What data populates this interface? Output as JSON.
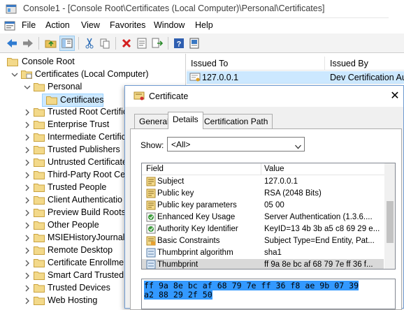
{
  "window": {
    "title": "Console1 - [Console Root\\Certificates (Local Computer)\\Personal\\Certificates]"
  },
  "menubar": [
    "File",
    "Action",
    "View",
    "Favorites",
    "Window",
    "Help"
  ],
  "toolbar": {
    "buttons": [
      "back-icon",
      "forward-icon",
      "up-folder-icon",
      "show-hide-tree-icon",
      "cut-icon",
      "copy-icon",
      "delete-icon",
      "properties-icon",
      "export-icon",
      "help-icon",
      "help-book-icon"
    ]
  },
  "tree": {
    "items": [
      {
        "label": "Console Root"
      },
      {
        "label": "Certificates (Local Computer)"
      },
      {
        "label": "Personal"
      },
      {
        "label": "Certificates"
      },
      {
        "label": "Trusted Root Certific"
      },
      {
        "label": "Enterprise Trust"
      },
      {
        "label": "Intermediate Certific"
      },
      {
        "label": "Trusted Publishers"
      },
      {
        "label": "Untrusted Certificate"
      },
      {
        "label": "Third-Party Root Ce"
      },
      {
        "label": "Trusted People"
      },
      {
        "label": "Client Authenticatio"
      },
      {
        "label": "Preview Build Roots"
      },
      {
        "label": "Other People"
      },
      {
        "label": "MSIEHistoryJournal"
      },
      {
        "label": "Remote Desktop"
      },
      {
        "label": "Certificate Enrollmer"
      },
      {
        "label": "Smart Card Trusted R"
      },
      {
        "label": "Trusted Devices"
      },
      {
        "label": "Web Hosting"
      }
    ]
  },
  "list": {
    "columns": [
      "Issued To",
      "Issued By"
    ],
    "rows": [
      {
        "issued_to": "127.0.0.1",
        "issued_by": "Dev Certification Au"
      }
    ]
  },
  "dialog": {
    "title": "Certificate",
    "tabs": [
      "General",
      "Details",
      "Certification Path"
    ],
    "active_tab": "Details",
    "show_label": "Show:",
    "show_value": "<All>",
    "fields_columns": [
      "Field",
      "Value"
    ],
    "fields": [
      {
        "field": "Subject",
        "value": "127.0.0.1",
        "icon": "cert-field-icon"
      },
      {
        "field": "Public key",
        "value": "RSA (2048 Bits)",
        "icon": "cert-field-icon"
      },
      {
        "field": "Public key parameters",
        "value": "05 00",
        "icon": "cert-field-icon"
      },
      {
        "field": "Enhanced Key Usage",
        "value": "Server Authentication (1.3.6....",
        "icon": "extension-icon"
      },
      {
        "field": "Authority Key Identifier",
        "value": "KeyID=13 4b 3b a5 c8 69 29 e...",
        "icon": "extension-icon"
      },
      {
        "field": "Basic Constraints",
        "value": "Subject Type=End Entity, Pat...",
        "icon": "critical-extension-icon"
      },
      {
        "field": "Thumbprint algorithm",
        "value": "sha1",
        "icon": "property-icon"
      },
      {
        "field": "Thumbprint",
        "value": "ff 9a 8e bc af 68 79 7e ff 36 f...",
        "icon": "property-icon"
      }
    ],
    "selected_field": "Thumbprint",
    "value_lines": [
      "ff 9a 8e bc af 68 79 7e ff 36 f8 ae 9b 07 39",
      "a2 88 29 2f 50"
    ]
  },
  "colors": {
    "selection": "#cce8ff",
    "folder": "#e8c25a",
    "hex_highlight": "#3399ff"
  }
}
